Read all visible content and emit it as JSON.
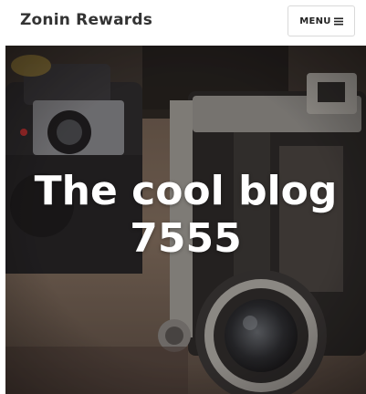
{
  "header": {
    "site_title": "Zonin Rewards",
    "menu_label": "MENU"
  },
  "hero": {
    "title_line1": "The cool blog",
    "title_line2": "7555",
    "image_icon": "camera-photo"
  },
  "colors": {
    "title_text": "#333333",
    "menu_border": "#d9d9d9",
    "hero_text": "#ffffff"
  }
}
